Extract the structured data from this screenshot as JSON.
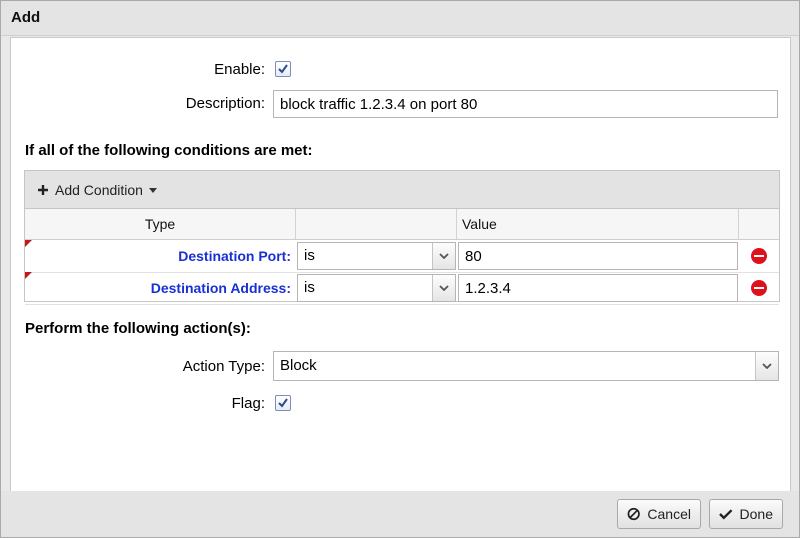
{
  "window": {
    "title": "Add"
  },
  "form": {
    "enable_label": "Enable:",
    "enable_checked": true,
    "description_label": "Description:",
    "description_value": "block traffic 1.2.3.4 on port 80"
  },
  "conditions": {
    "heading": "If all of the following conditions are met:",
    "add_label": "Add Condition",
    "columns": {
      "type": "Type",
      "op": "",
      "value": "Value",
      "action": ""
    },
    "rows": [
      {
        "type": "Destination Port:",
        "op": "is",
        "value": "80"
      },
      {
        "type": "Destination Address:",
        "op": "is",
        "value": "1.2.3.4"
      }
    ]
  },
  "actions": {
    "heading": "Perform the following action(s):",
    "type_label": "Action Type:",
    "type_value": "Block",
    "flag_label": "Flag:",
    "flag_checked": true
  },
  "footer": {
    "cancel_label": "Cancel",
    "done_label": "Done"
  },
  "icons": {
    "plus": "plus-icon",
    "dropdown": "caret-down-icon",
    "remove": "remove-circle-icon",
    "cancel": "cancel-icon",
    "done": "check-icon"
  },
  "colors": {
    "condition_type": "#1a2fd4",
    "remove": "#e0101a"
  }
}
